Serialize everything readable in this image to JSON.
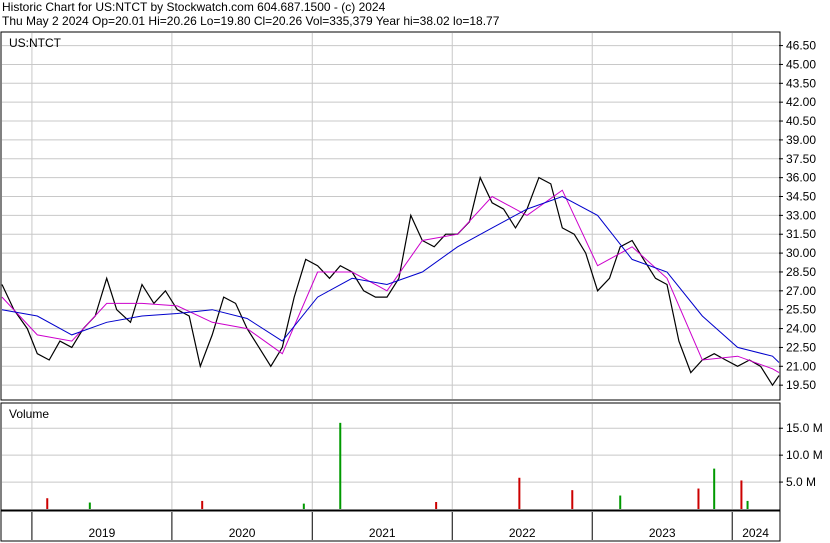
{
  "header": {
    "line1": "Historic Chart for US:NTCT by Stockwatch.com 604.687.1500 - (c) 2024",
    "line2": "Thu May  2 2024  Op=20.01  Hi=20.26  Lo=19.80  Cl=20.26  Vol=335,379  Year hi=38.02  lo=18.77"
  },
  "colors": {
    "price": "#000000",
    "ma_short": "#cc00cc",
    "ma_long": "#0000cc",
    "volume_up": "#009900",
    "volume_down": "#cc0000",
    "grid": "#c8c8c8"
  },
  "chart_data": [
    {
      "type": "line",
      "title": "US:NTCT",
      "y_ticks": [
        "46.50",
        "45.00",
        "43.50",
        "42.00",
        "40.50",
        "39.00",
        "37.50",
        "36.00",
        "34.50",
        "33.00",
        "31.50",
        "30.00",
        "28.50",
        "27.00",
        "25.50",
        "24.00",
        "22.50",
        "21.00",
        "19.50"
      ],
      "ylim": [
        18.4,
        47.5
      ],
      "x_ticks": [
        "2019",
        "2020",
        "2021",
        "2022",
        "2023",
        "2024"
      ],
      "x_tick_dates": [
        "2019-01-01",
        "2020-01-01",
        "2021-01-01",
        "2022-01-01",
        "2023-01-01",
        "2024-01-01"
      ],
      "xlim": [
        "2018-10-15",
        "2024-05-02"
      ],
      "grid": true,
      "series": [
        {
          "name": "price",
          "x": [
            "2018-10-15",
            "2018-11-15",
            "2018-12-20",
            "2019-01-15",
            "2019-02-15",
            "2019-03-15",
            "2019-04-15",
            "2019-05-15",
            "2019-06-15",
            "2019-07-15",
            "2019-08-10",
            "2019-09-15",
            "2019-10-15",
            "2019-11-15",
            "2019-12-15",
            "2020-01-15",
            "2020-02-15",
            "2020-03-15",
            "2020-04-15",
            "2020-05-15",
            "2020-06-15",
            "2020-07-15",
            "2020-08-15",
            "2020-09-15",
            "2020-10-15",
            "2020-11-15",
            "2020-12-15",
            "2021-01-15",
            "2021-02-15",
            "2021-03-15",
            "2021-04-15",
            "2021-05-15",
            "2021-06-15",
            "2021-07-15",
            "2021-08-15",
            "2021-09-15",
            "2021-10-15",
            "2021-11-15",
            "2021-12-15",
            "2022-01-15",
            "2022-02-15",
            "2022-03-15",
            "2022-04-15",
            "2022-05-15",
            "2022-06-15",
            "2022-07-15",
            "2022-08-15",
            "2022-09-15",
            "2022-10-15",
            "2022-11-15",
            "2022-12-15",
            "2023-01-15",
            "2023-02-15",
            "2023-03-15",
            "2023-04-15",
            "2023-05-15",
            "2023-06-15",
            "2023-07-15",
            "2023-08-15",
            "2023-09-15",
            "2023-10-15",
            "2023-11-15",
            "2023-12-15",
            "2024-01-15",
            "2024-02-15",
            "2024-03-15",
            "2024-04-15",
            "2024-05-02"
          ],
          "y": [
            27.5,
            25.5,
            24.0,
            22.0,
            21.5,
            23.0,
            22.5,
            24.0,
            25.0,
            28.0,
            25.5,
            24.5,
            27.5,
            26.0,
            27.0,
            25.5,
            25.0,
            21.0,
            23.5,
            26.5,
            26.0,
            24.0,
            22.5,
            21.0,
            22.5,
            26.5,
            29.5,
            29.0,
            28.0,
            29.0,
            28.5,
            27.0,
            26.5,
            26.5,
            28.0,
            33.0,
            31.0,
            30.5,
            31.5,
            31.5,
            32.5,
            36.0,
            34.0,
            33.5,
            32.0,
            33.5,
            36.0,
            35.5,
            32.0,
            31.5,
            30.0,
            27.0,
            28.0,
            30.5,
            31.0,
            29.5,
            28.0,
            27.5,
            23.0,
            20.5,
            21.5,
            22.0,
            21.5,
            21.0,
            21.5,
            21.0,
            19.5,
            20.26
          ]
        },
        {
          "name": "ma_short",
          "x": [
            "2018-10-15",
            "2019-01-15",
            "2019-04-15",
            "2019-07-15",
            "2019-10-15",
            "2020-01-15",
            "2020-04-15",
            "2020-07-15",
            "2020-10-15",
            "2021-01-15",
            "2021-04-15",
            "2021-07-15",
            "2021-10-15",
            "2022-01-15",
            "2022-04-15",
            "2022-07-15",
            "2022-10-15",
            "2023-01-15",
            "2023-04-15",
            "2023-07-15",
            "2023-10-15",
            "2024-01-15",
            "2024-04-15",
            "2024-05-02"
          ],
          "y": [
            26.5,
            23.5,
            23.0,
            26.0,
            26.0,
            25.8,
            24.5,
            24.0,
            22.0,
            28.5,
            28.5,
            27.0,
            31.0,
            31.5,
            34.5,
            33.0,
            35.0,
            29.0,
            30.5,
            28.0,
            21.5,
            21.8,
            20.8,
            20.5
          ]
        },
        {
          "name": "ma_long",
          "x": [
            "2018-10-15",
            "2019-01-15",
            "2019-04-15",
            "2019-07-15",
            "2019-10-15",
            "2020-01-15",
            "2020-04-15",
            "2020-07-15",
            "2020-10-15",
            "2021-01-15",
            "2021-04-15",
            "2021-07-15",
            "2021-10-15",
            "2022-01-15",
            "2022-04-15",
            "2022-07-15",
            "2022-10-15",
            "2023-01-15",
            "2023-04-15",
            "2023-07-15",
            "2023-10-15",
            "2024-01-15",
            "2024-04-15",
            "2024-05-02"
          ],
          "y": [
            25.5,
            25.0,
            23.5,
            24.5,
            25.0,
            25.2,
            25.5,
            24.8,
            23.0,
            26.5,
            28.0,
            27.5,
            28.5,
            30.5,
            32.0,
            33.5,
            34.5,
            33.0,
            29.5,
            28.5,
            25.0,
            22.5,
            21.8,
            21.3
          ]
        }
      ]
    },
    {
      "type": "bar",
      "title": "Volume",
      "y_ticks": [
        "15.0 M",
        "10.0 M",
        "5.0 M"
      ],
      "ylim": [
        0,
        19.5
      ],
      "x": [
        "2019-02-10",
        "2019-06-01",
        "2020-03-20",
        "2020-12-10",
        "2021-03-15",
        "2021-11-20",
        "2022-06-25",
        "2022-11-10",
        "2023-03-15",
        "2023-10-05",
        "2023-11-15",
        "2024-01-25",
        "2024-02-10"
      ],
      "values": [
        2.0,
        1.2,
        1.5,
        1.0,
        16.0,
        1.3,
        5.8,
        3.5,
        2.5,
        3.8,
        7.5,
        5.3,
        1.5
      ],
      "colors": [
        "down",
        "up",
        "down",
        "up",
        "up",
        "down",
        "down",
        "down",
        "up",
        "down",
        "up",
        "down",
        "up"
      ]
    }
  ]
}
